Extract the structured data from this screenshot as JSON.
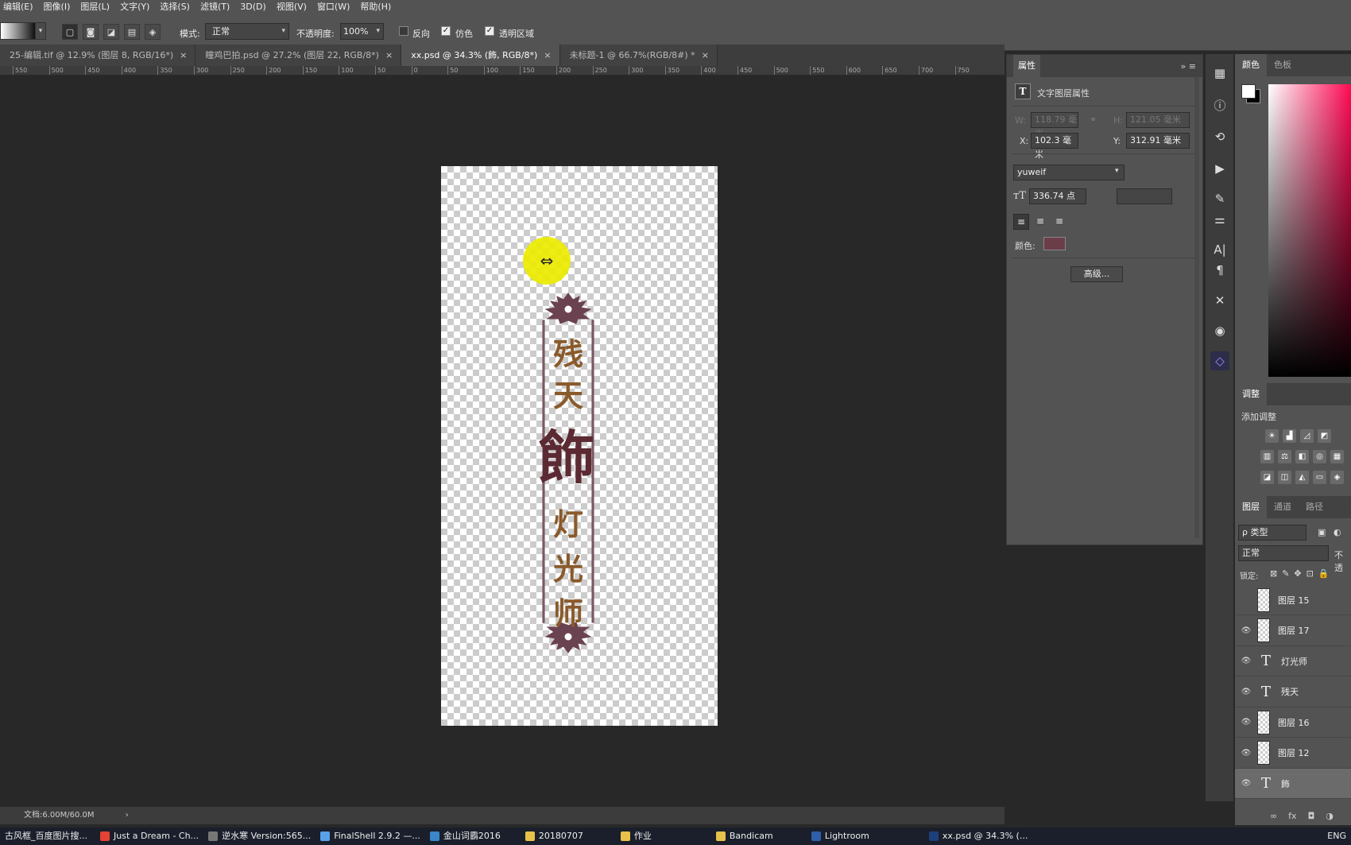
{
  "menu": [
    "编辑(E)",
    "图像(I)",
    "图层(L)",
    "文字(Y)",
    "选择(S)",
    "滤镜(T)",
    "3D(D)",
    "视图(V)",
    "窗口(W)",
    "帮助(H)"
  ],
  "options": {
    "mode_label": "模式:",
    "mode_value": "正常",
    "opacity_label": "不透明度:",
    "opacity_value": "100%",
    "reverse_label": "反向",
    "dither_label": "仿色",
    "transparency_label": "透明区域",
    "reverse_checked": false,
    "dither_checked": true,
    "transparency_checked": true
  },
  "tabs": [
    {
      "label": "25-编辑.tif @ 12.9% (图层 8, RGB/16*)",
      "close": "×"
    },
    {
      "label": "瞳鸡巴拍.psd @ 27.2% (图层 22, RGB/8*)",
      "close": "×"
    },
    {
      "label": "xx.psd @ 34.3% (飾, RGB/8*)",
      "close": "×"
    },
    {
      "label": "未标题-1 @ 66.7%(RGB/8#) *",
      "close": "×"
    }
  ],
  "ruler_ticks": [
    "550",
    "500",
    "450",
    "400",
    "350",
    "300",
    "250",
    "200",
    "150",
    "100",
    "50",
    "0",
    "50",
    "100",
    "150",
    "200",
    "250",
    "300",
    "350",
    "400",
    "450",
    "500",
    "550",
    "600",
    "650",
    "700",
    "750"
  ],
  "artwork": {
    "top_chars": [
      "残",
      "天"
    ],
    "big_char": "飾",
    "bottom_chars": [
      "灯",
      "光",
      "师"
    ],
    "text_color": "#8a5a2b",
    "big_color": "#5c2a33"
  },
  "status": {
    "doc_size": "文档:6.00M/60.0M",
    "arrow": "›"
  },
  "properties": {
    "tab": "属性",
    "menu": "»  ≡",
    "section_title": "文字图层属性",
    "w_label": "W:",
    "w_value": "118.79 毫米",
    "h_label": "H:",
    "h_value": "121.05 毫米",
    "x_label": "X:",
    "x_value": "102.3 毫米",
    "y_label": "Y:",
    "y_value": "312.91 毫米",
    "font": "yuweif",
    "size": "336.74 点",
    "color_label": "颜色:",
    "color_value": "#6b3d48",
    "advanced": "高级..."
  },
  "color_panel": {
    "tab_color": "颜色",
    "tab_swatches": "色板"
  },
  "adjustments": {
    "tab": "调整",
    "add_label": "添加调整"
  },
  "layers_panel": {
    "tabs": [
      "图层",
      "通道",
      "路径"
    ],
    "filter": "ρ 类型",
    "blend": "正常",
    "opacity_label": "不透",
    "lock_label": "锁定:",
    "layers": [
      {
        "name": "图层 15",
        "type": "raster",
        "visible": false,
        "selected": false
      },
      {
        "name": "图层 17",
        "type": "raster",
        "visible": true,
        "selected": false
      },
      {
        "name": "灯光师",
        "type": "text",
        "visible": true,
        "selected": false
      },
      {
        "name": "残天",
        "type": "text",
        "visible": true,
        "selected": false
      },
      {
        "name": "图层 16",
        "type": "raster",
        "visible": true,
        "selected": false
      },
      {
        "name": "图层 12",
        "type": "raster",
        "visible": true,
        "selected": false
      },
      {
        "name": "飾",
        "type": "text",
        "visible": true,
        "selected": true
      }
    ],
    "footer": [
      "∞",
      "fx",
      "◘",
      "◑"
    ]
  },
  "taskbar": [
    {
      "label": "古风框_百度图片搜...",
      "color": "#2a6fd6"
    },
    {
      "label": "Just a Dream - Ch...",
      "color": "#e34234"
    },
    {
      "label": "逆水寒 Version:565...",
      "color": "#777777"
    },
    {
      "label": "FinalShell 2.9.2 —...",
      "color": "#5aa0e6"
    },
    {
      "label": "金山词霸2016",
      "color": "#3a86c8"
    },
    {
      "label": "20180707",
      "color": "#e8c14a"
    },
    {
      "label": "作业",
      "color": "#e8c14a"
    },
    {
      "label": "Bandicam",
      "color": "#e8c14a"
    },
    {
      "label": "Lightroom",
      "color": "#2e5fa8"
    },
    {
      "label": "xx.psd @ 34.3% (...",
      "color": "#1f3f7a"
    },
    {
      "label": "ENG",
      "color": "#1a1f2b"
    }
  ]
}
